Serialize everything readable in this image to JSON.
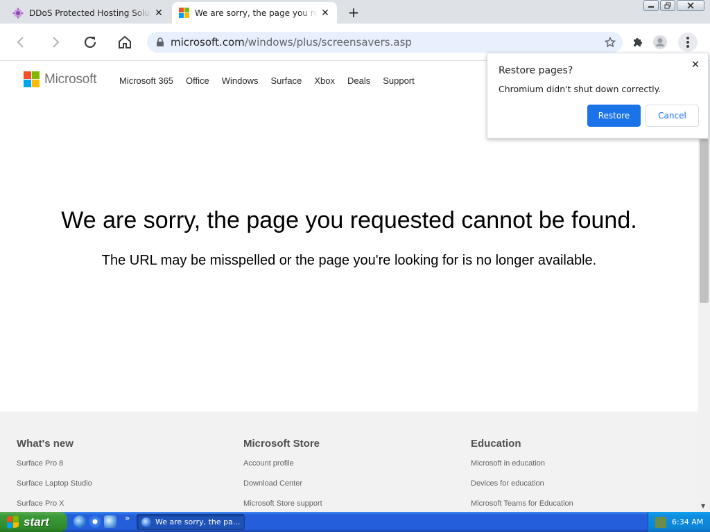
{
  "browser": {
    "tabs": [
      {
        "title": "DDoS Protected Hosting Soluti",
        "active": false
      },
      {
        "title": "We are sorry, the page you re",
        "active": true
      }
    ],
    "new_tab": "+",
    "url_host": "microsoft.com",
    "url_path": "/windows/plus/screensavers.asp"
  },
  "popup": {
    "title": "Restore pages?",
    "message": "Chromium didn't shut down correctly.",
    "restore_label": "Restore",
    "cancel_label": "Cancel"
  },
  "page": {
    "logo_text": "Microsoft",
    "nav": [
      "Microsoft 365",
      "Office",
      "Windows",
      "Surface",
      "Xbox",
      "Deals",
      "Support"
    ],
    "heading": "We are sorry, the page you requested cannot be found.",
    "subtext": "The URL may be misspelled or the page you're looking for is no longer available.",
    "footer": [
      {
        "heading": "What's new",
        "links": [
          "Surface Pro 8",
          "Surface Laptop Studio",
          "Surface Pro X"
        ]
      },
      {
        "heading": "Microsoft Store",
        "links": [
          "Account profile",
          "Download Center",
          "Microsoft Store support"
        ]
      },
      {
        "heading": "Education",
        "links": [
          "Microsoft in education",
          "Devices for education",
          "Microsoft Teams for Education"
        ]
      }
    ]
  },
  "taskbar": {
    "start_label": "start",
    "task_title": "We are sorry, the pa...",
    "clock": "6:34 AM"
  },
  "colors": {
    "accent": "#1a73e8",
    "logo_red": "#f25022",
    "logo_green": "#7fba00",
    "logo_blue": "#00a4ef",
    "logo_yellow": "#ffb900"
  }
}
